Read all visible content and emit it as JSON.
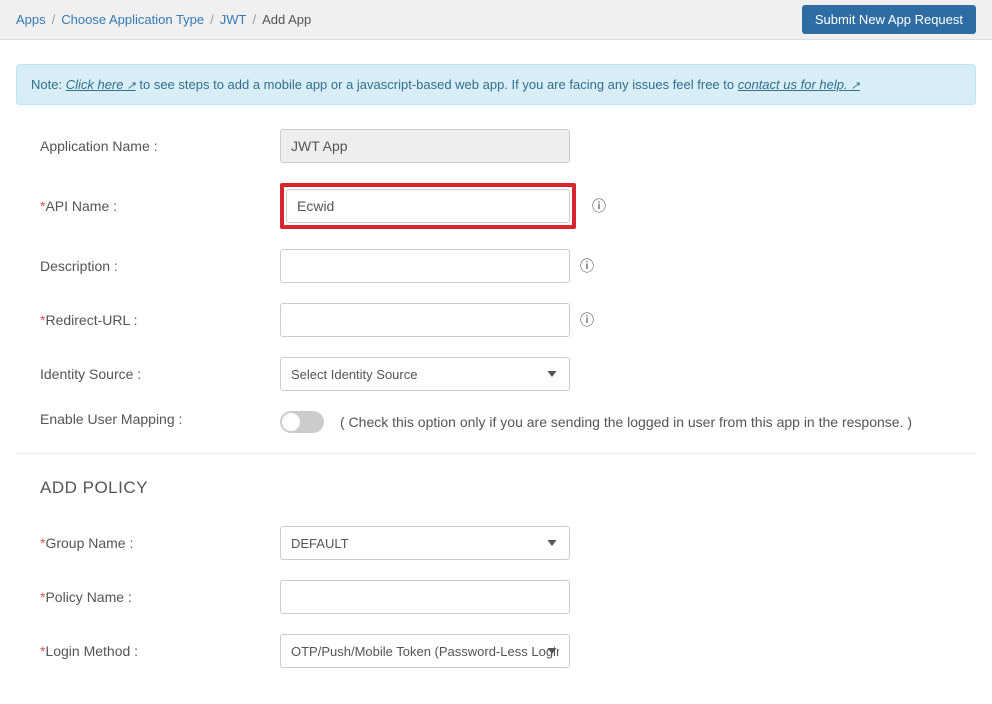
{
  "breadcrumb": {
    "apps": "Apps",
    "choose": "Choose Application Type",
    "jwt": "JWT",
    "addapp": "Add App"
  },
  "header": {
    "submit_button": "Submit New App Request"
  },
  "note": {
    "prefix": "Note: ",
    "click_here": "Click here",
    "middle": " to see steps to add a mobile app or a javascript-based web app. If you are facing any issues feel free to ",
    "contact": "contact us for help."
  },
  "form": {
    "app_name_label": "Application Name :",
    "app_name_value": "JWT App",
    "api_name_label": "API Name :",
    "api_name_value": "Ecwid",
    "description_label": "Description :",
    "description_value": "",
    "redirect_label": "Redirect-URL :",
    "redirect_value": "",
    "identity_label": "Identity Source :",
    "identity_placeholder": "Select Identity Source",
    "mapping_label": "Enable User Mapping :",
    "mapping_hint": "( Check this option only if you are sending the logged in user from this app in the response. )"
  },
  "policy": {
    "title": "ADD POLICY",
    "group_label": "Group Name :",
    "group_value": "DEFAULT",
    "policy_label": "Policy Name :",
    "policy_value": "",
    "login_label": "Login Method :",
    "login_value": "OTP/Push/Mobile Token (Password-Less Login)"
  }
}
